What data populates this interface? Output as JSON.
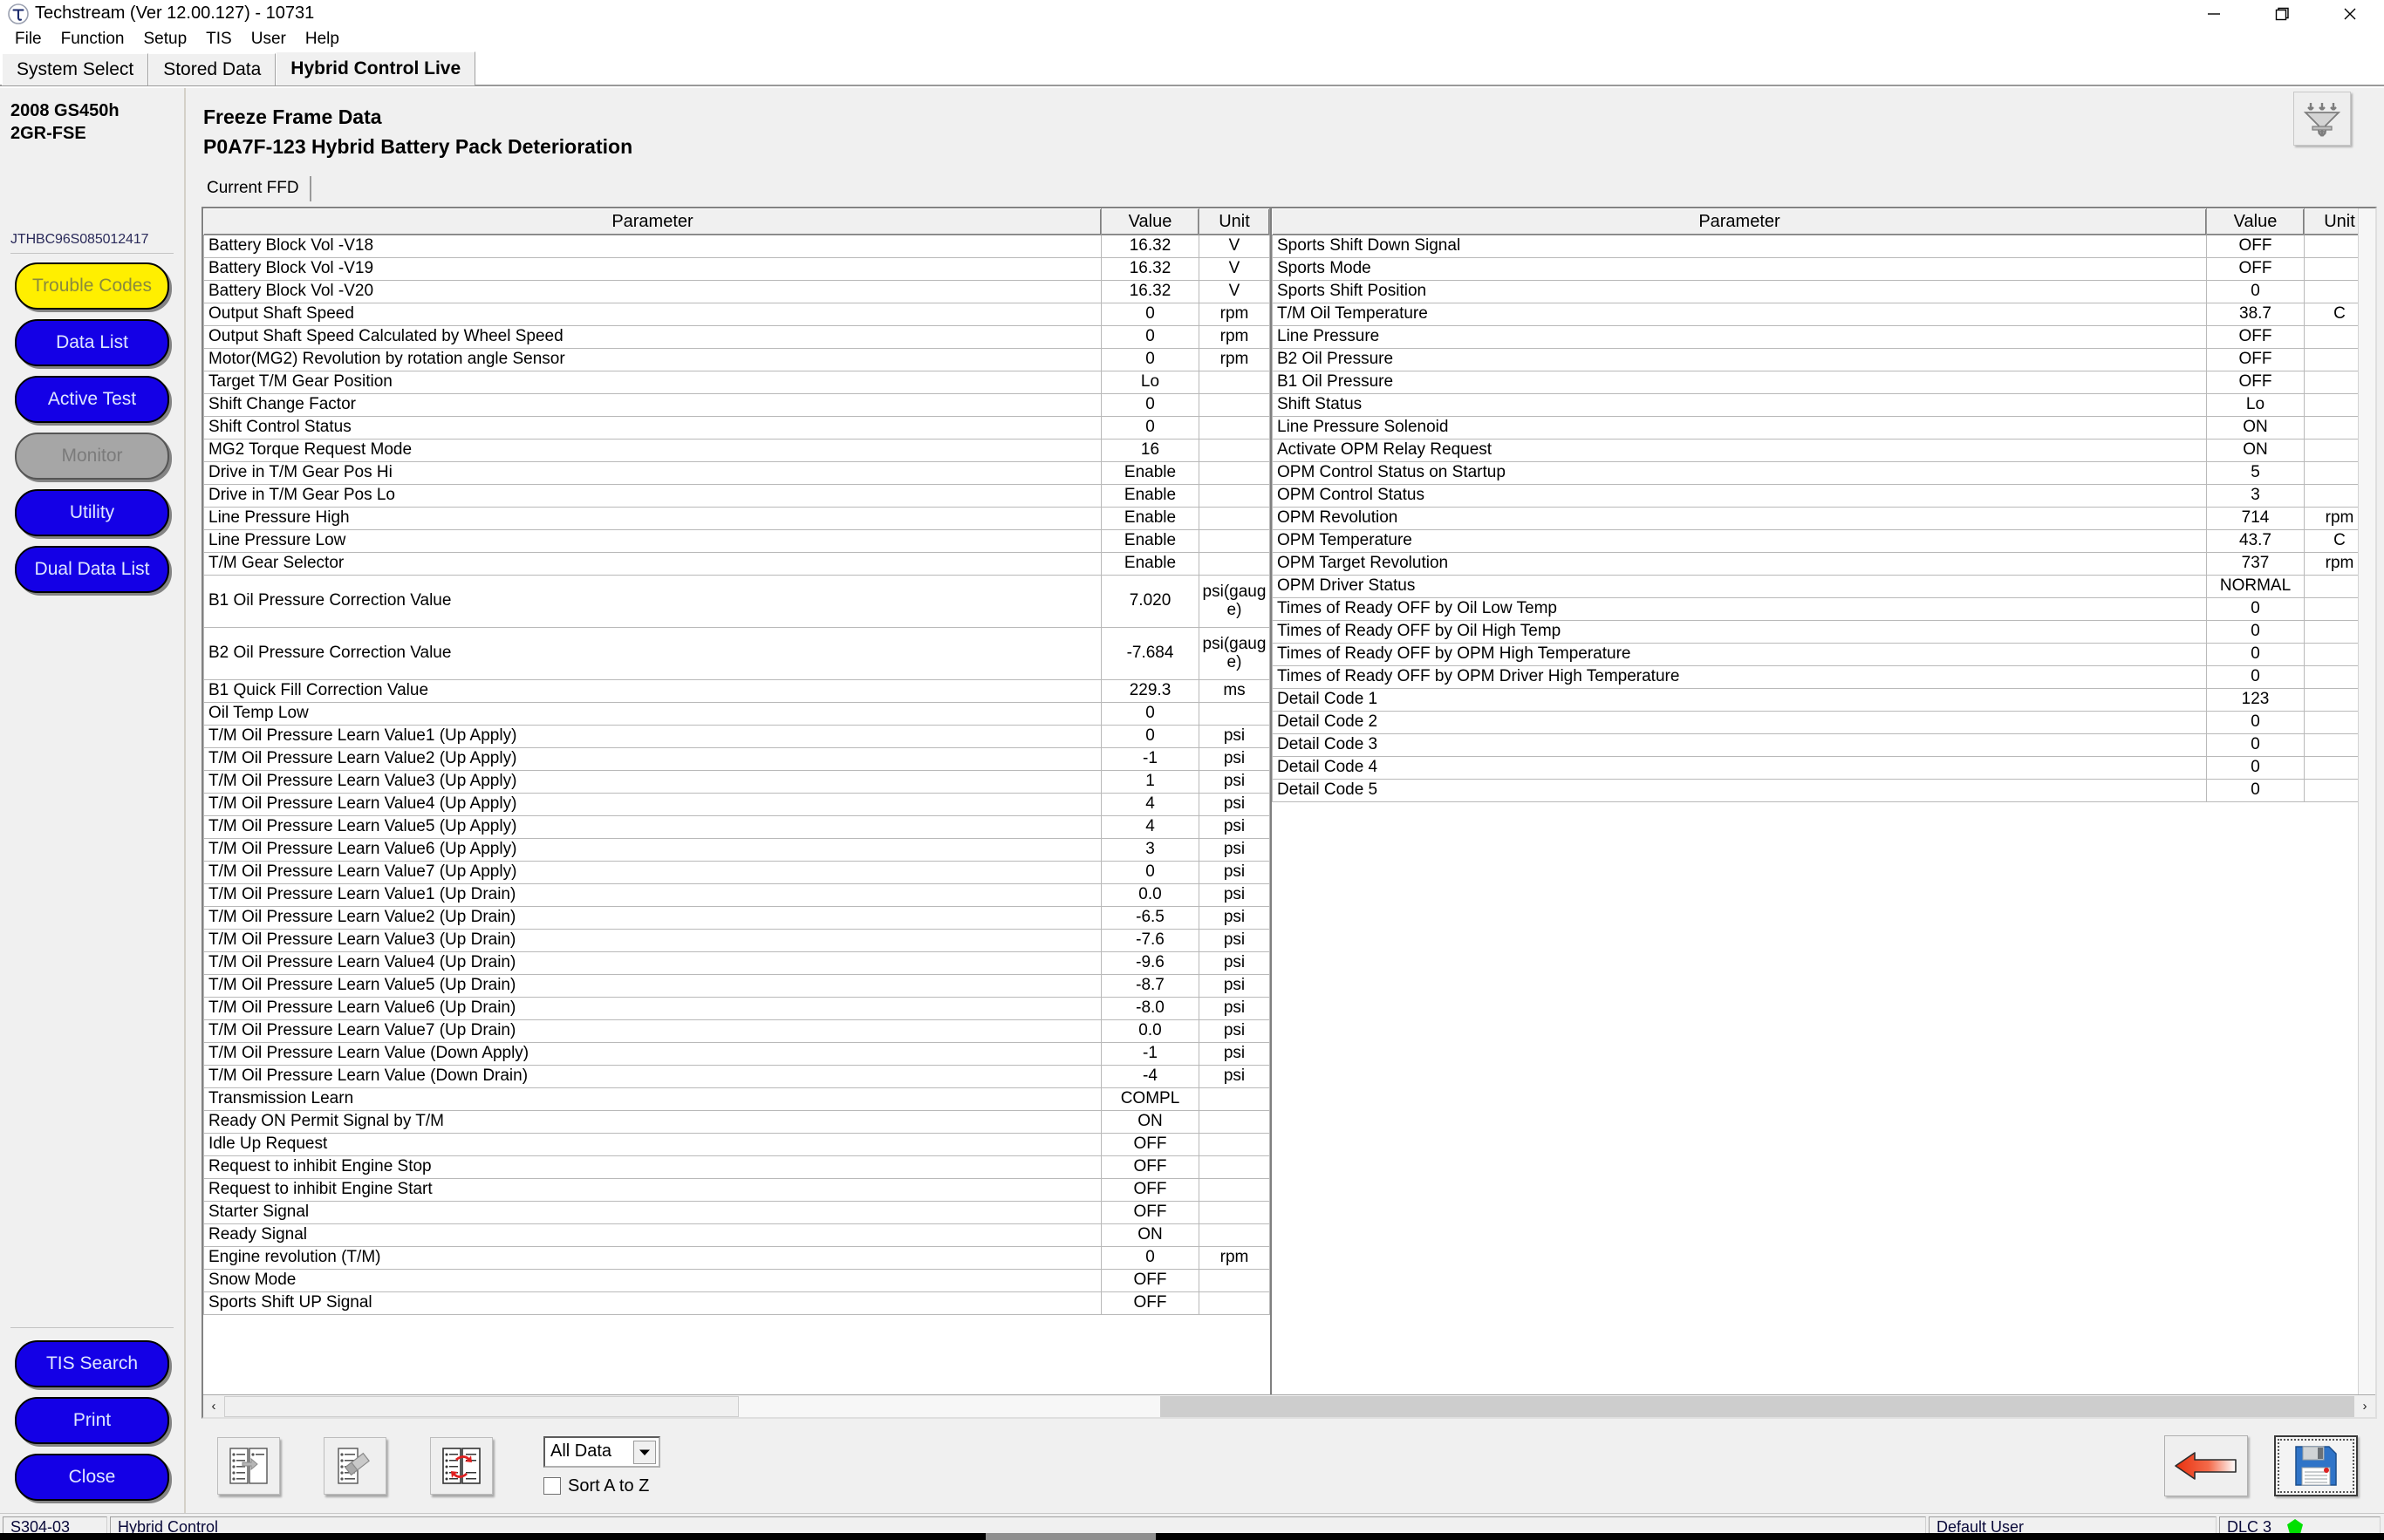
{
  "window": {
    "title": "Techstream (Ver 12.00.127) - 10731",
    "app_icon": "techstream-logo-icon",
    "minimize_label": "Minimize",
    "maximize_label": "Restore",
    "close_label": "Close"
  },
  "menubar": {
    "items": [
      "File",
      "Function",
      "Setup",
      "TIS",
      "User",
      "Help"
    ]
  },
  "tabs": [
    {
      "label": "System Select",
      "active": false
    },
    {
      "label": "Stored Data",
      "active": false
    },
    {
      "label": "Hybrid Control Live",
      "active": true
    }
  ],
  "sidebar": {
    "vehicle_line1": "2008 GS450h",
    "vehicle_line2": "2GR-FSE",
    "vin": "JTHBC96S085012417",
    "buttons": [
      {
        "label": "Trouble Codes",
        "style": "yellow"
      },
      {
        "label": "Data List",
        "style": "blue"
      },
      {
        "label": "Active Test",
        "style": "blue"
      },
      {
        "label": "Monitor",
        "style": "gray"
      },
      {
        "label": "Utility",
        "style": "blue"
      },
      {
        "label": "Dual Data List",
        "style": "blue"
      }
    ],
    "bottom_buttons": [
      {
        "label": "TIS Search"
      },
      {
        "label": "Print"
      },
      {
        "label": "Close"
      }
    ]
  },
  "content": {
    "title": "Freeze Frame Data",
    "subtitle": "P0A7F-123 Hybrid Battery Pack Deterioration",
    "filter_icon": "funnel-filter-icon",
    "subtab": "Current FFD"
  },
  "table": {
    "headers": {
      "parameter": "Parameter",
      "value": "Value",
      "unit": "Unit"
    },
    "left_rows": [
      {
        "parameter": "Battery Block Vol -V18",
        "value": "16.32",
        "unit": "V"
      },
      {
        "parameter": "Battery Block Vol -V19",
        "value": "16.32",
        "unit": "V"
      },
      {
        "parameter": "Battery Block Vol -V20",
        "value": "16.32",
        "unit": "V"
      },
      {
        "parameter": "Output Shaft Speed",
        "value": "0",
        "unit": "rpm"
      },
      {
        "parameter": "Output Shaft Speed Calculated by Wheel Speed",
        "value": "0",
        "unit": "rpm"
      },
      {
        "parameter": "Motor(MG2) Revolution by rotation angle Sensor",
        "value": "0",
        "unit": "rpm"
      },
      {
        "parameter": "Target T/M Gear Position",
        "value": "Lo",
        "unit": ""
      },
      {
        "parameter": "Shift Change Factor",
        "value": "0",
        "unit": ""
      },
      {
        "parameter": "Shift Control Status",
        "value": "0",
        "unit": ""
      },
      {
        "parameter": "MG2 Torque Request Mode",
        "value": "16",
        "unit": ""
      },
      {
        "parameter": "Drive in T/M Gear Pos Hi",
        "value": "Enable",
        "unit": ""
      },
      {
        "parameter": "Drive in T/M Gear Pos Lo",
        "value": "Enable",
        "unit": ""
      },
      {
        "parameter": "Line Pressure High",
        "value": "Enable",
        "unit": ""
      },
      {
        "parameter": "Line Pressure Low",
        "value": "Enable",
        "unit": ""
      },
      {
        "parameter": "T/M Gear Selector",
        "value": "Enable",
        "unit": ""
      },
      {
        "parameter": "B1 Oil Pressure Correction Value",
        "value": "7.020",
        "unit": "psi(gauge)",
        "tall": true
      },
      {
        "parameter": "B2 Oil Pressure Correction Value",
        "value": "-7.684",
        "unit": "psi(gauge)",
        "tall": true
      },
      {
        "parameter": "B1 Quick Fill Correction Value",
        "value": "229.3",
        "unit": "ms"
      },
      {
        "parameter": "Oil Temp Low",
        "value": "0",
        "unit": ""
      },
      {
        "parameter": "T/M Oil Pressure Learn Value1 (Up Apply)",
        "value": "0",
        "unit": "psi"
      },
      {
        "parameter": "T/M Oil Pressure Learn Value2 (Up Apply)",
        "value": "-1",
        "unit": "psi"
      },
      {
        "parameter": "T/M Oil Pressure Learn Value3 (Up Apply)",
        "value": "1",
        "unit": "psi"
      },
      {
        "parameter": "T/M Oil Pressure Learn Value4 (Up Apply)",
        "value": "4",
        "unit": "psi"
      },
      {
        "parameter": "T/M Oil Pressure Learn Value5 (Up Apply)",
        "value": "4",
        "unit": "psi"
      },
      {
        "parameter": "T/M Oil Pressure Learn Value6 (Up Apply)",
        "value": "3",
        "unit": "psi"
      },
      {
        "parameter": "T/M Oil Pressure Learn Value7 (Up Apply)",
        "value": "0",
        "unit": "psi"
      },
      {
        "parameter": "T/M Oil Pressure Learn Value1 (Up Drain)",
        "value": "0.0",
        "unit": "psi"
      },
      {
        "parameter": "T/M Oil Pressure Learn Value2 (Up Drain)",
        "value": "-6.5",
        "unit": "psi"
      },
      {
        "parameter": "T/M Oil Pressure Learn Value3 (Up Drain)",
        "value": "-7.6",
        "unit": "psi"
      },
      {
        "parameter": "T/M Oil Pressure Learn Value4 (Up Drain)",
        "value": "-9.6",
        "unit": "psi"
      },
      {
        "parameter": "T/M Oil Pressure Learn Value5 (Up Drain)",
        "value": "-8.7",
        "unit": "psi"
      },
      {
        "parameter": "T/M Oil Pressure Learn Value6 (Up Drain)",
        "value": "-8.0",
        "unit": "psi"
      },
      {
        "parameter": "T/M Oil Pressure Learn Value7 (Up Drain)",
        "value": "0.0",
        "unit": "psi"
      },
      {
        "parameter": "T/M Oil Pressure Learn Value (Down Apply)",
        "value": "-1",
        "unit": "psi"
      },
      {
        "parameter": "T/M Oil Pressure Learn Value (Down Drain)",
        "value": "-4",
        "unit": "psi"
      },
      {
        "parameter": "Transmission Learn",
        "value": "COMPL",
        "unit": ""
      },
      {
        "parameter": "Ready ON Permit Signal by T/M",
        "value": "ON",
        "unit": ""
      },
      {
        "parameter": "Idle Up Request",
        "value": "OFF",
        "unit": ""
      },
      {
        "parameter": "Request to inhibit Engine Stop",
        "value": "OFF",
        "unit": ""
      },
      {
        "parameter": "Request to inhibit Engine Start",
        "value": "OFF",
        "unit": ""
      },
      {
        "parameter": "Starter Signal",
        "value": "OFF",
        "unit": ""
      },
      {
        "parameter": "Ready Signal",
        "value": "ON",
        "unit": ""
      },
      {
        "parameter": "Engine revolution (T/M)",
        "value": "0",
        "unit": "rpm"
      },
      {
        "parameter": "Snow Mode",
        "value": "OFF",
        "unit": ""
      },
      {
        "parameter": "Sports Shift UP Signal",
        "value": "OFF",
        "unit": ""
      }
    ],
    "right_rows": [
      {
        "parameter": "Sports Shift Down Signal",
        "value": "OFF",
        "unit": ""
      },
      {
        "parameter": "Sports Mode",
        "value": "OFF",
        "unit": ""
      },
      {
        "parameter": "Sports Shift Position",
        "value": "0",
        "unit": ""
      },
      {
        "parameter": "T/M Oil Temperature",
        "value": "38.7",
        "unit": "C"
      },
      {
        "parameter": "Line Pressure",
        "value": "OFF",
        "unit": ""
      },
      {
        "parameter": "B2 Oil Pressure",
        "value": "OFF",
        "unit": ""
      },
      {
        "parameter": "B1 Oil Pressure",
        "value": "OFF",
        "unit": ""
      },
      {
        "parameter": "Shift Status",
        "value": "Lo",
        "unit": ""
      },
      {
        "parameter": "Line Pressure Solenoid",
        "value": "ON",
        "unit": ""
      },
      {
        "parameter": "Activate OPM Relay Request",
        "value": "ON",
        "unit": ""
      },
      {
        "parameter": "OPM Control Status on Startup",
        "value": "5",
        "unit": ""
      },
      {
        "parameter": "OPM Control Status",
        "value": "3",
        "unit": ""
      },
      {
        "parameter": "OPM Revolution",
        "value": "714",
        "unit": "rpm"
      },
      {
        "parameter": "OPM Temperature",
        "value": "43.7",
        "unit": "C"
      },
      {
        "parameter": "OPM Target Revolution",
        "value": "737",
        "unit": "rpm"
      },
      {
        "parameter": "OPM Driver Status",
        "value": "NORMAL",
        "unit": ""
      },
      {
        "parameter": "Times of Ready OFF by Oil Low Temp",
        "value": "0",
        "unit": ""
      },
      {
        "parameter": "Times of Ready OFF by Oil High Temp",
        "value": "0",
        "unit": ""
      },
      {
        "parameter": "Times of Ready OFF by OPM High Temperature",
        "value": "0",
        "unit": ""
      },
      {
        "parameter": "Times of Ready OFF by OPM Driver High Temperature",
        "value": "0",
        "unit": ""
      },
      {
        "parameter": "Detail Code 1",
        "value": "123",
        "unit": ""
      },
      {
        "parameter": "Detail Code 2",
        "value": "0",
        "unit": ""
      },
      {
        "parameter": "Detail Code 3",
        "value": "0",
        "unit": ""
      },
      {
        "parameter": "Detail Code 4",
        "value": "0",
        "unit": ""
      },
      {
        "parameter": "Detail Code 5",
        "value": "0",
        "unit": ""
      }
    ],
    "scroll_left_arrow": "‹",
    "scroll_right_arrow": "›"
  },
  "footer": {
    "tool_buttons": [
      {
        "icon": "move-list-right-icon"
      },
      {
        "icon": "erase-list-icon"
      },
      {
        "icon": "swap-lists-icon"
      }
    ],
    "data_filter_value": "All Data",
    "data_filter_arrow": "▼",
    "sort_label": "Sort A to Z",
    "sort_checked": false,
    "back_icon": "back-arrow-icon",
    "save_icon": "floppy-save-icon"
  },
  "statusbar": {
    "code": "S304-03",
    "system": "Hybrid Control",
    "user": "Default User",
    "connection": "DLC 3",
    "indicator_color": "#00e000"
  }
}
